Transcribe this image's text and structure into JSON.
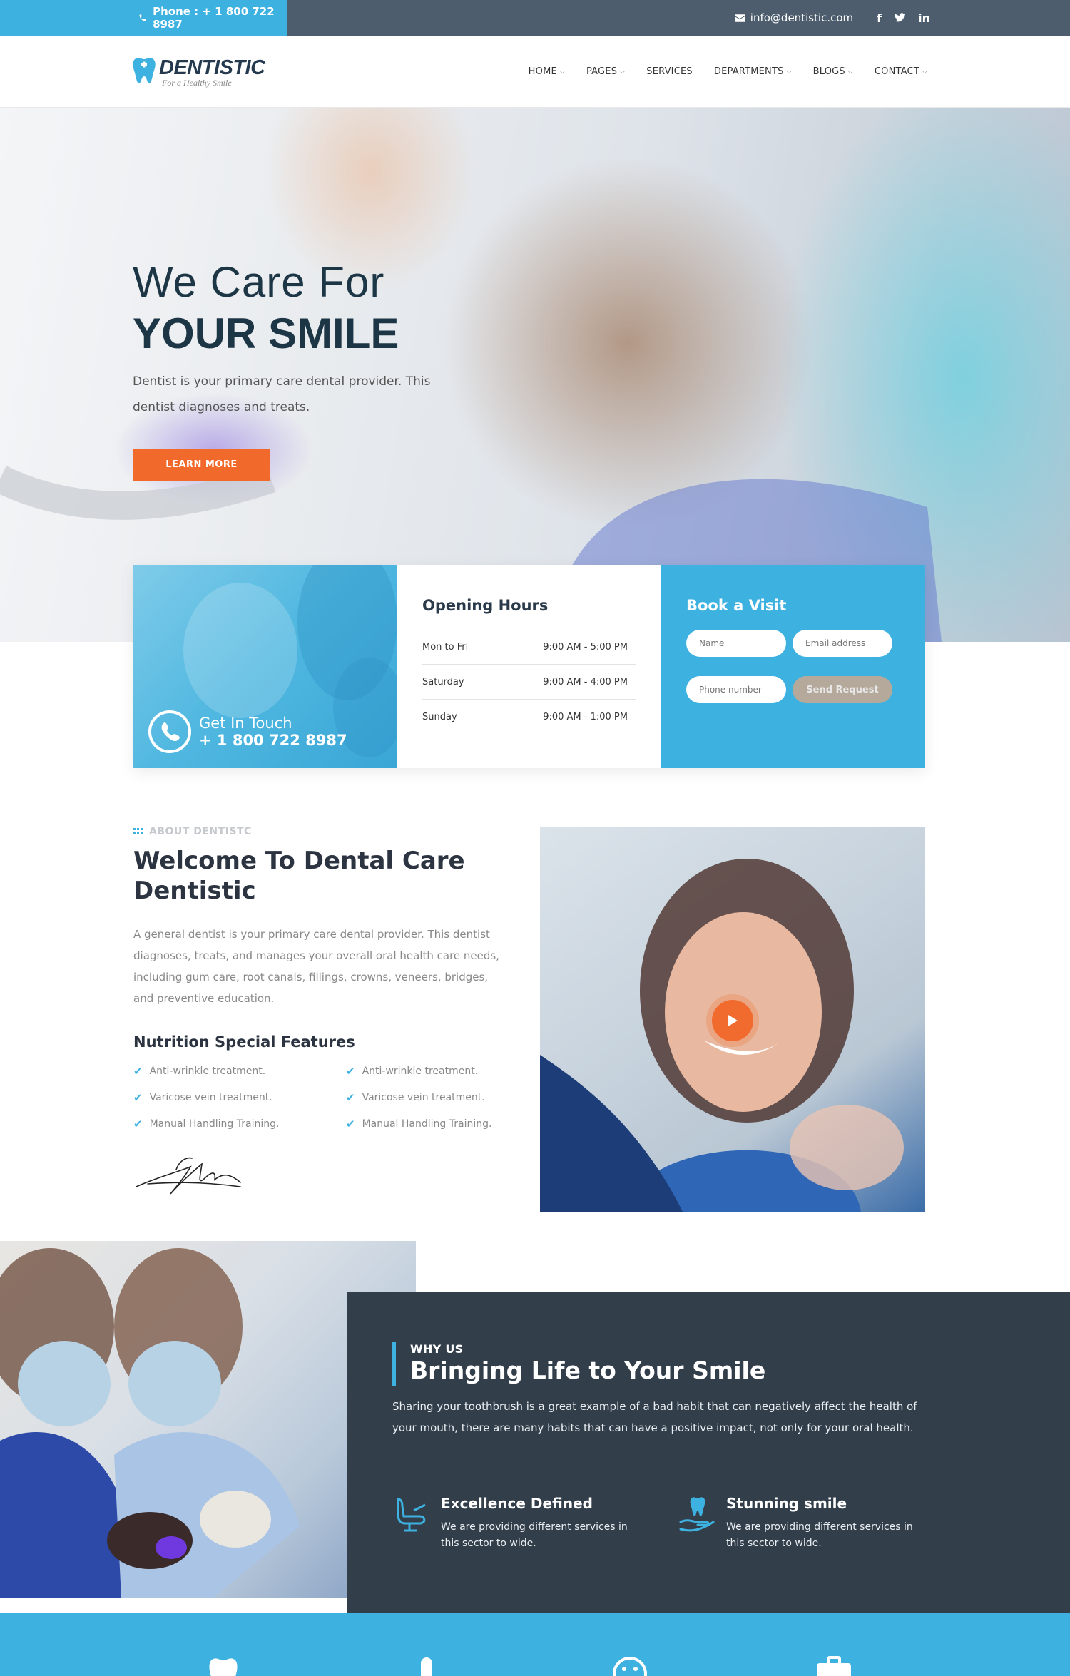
{
  "topbar": {
    "phone": "Phone : + 1 800 722 8987",
    "email": "info@dentistic.com",
    "social": [
      "f",
      "t",
      "in"
    ]
  },
  "brand": {
    "name": "DENTISTIC",
    "tagline": "For a Healthy Smile",
    "accent": "#3db1e0",
    "orange": "#f26a2b",
    "dark": "#333e4b"
  },
  "nav": {
    "items": [
      {
        "label": "HOME",
        "dropdown": true
      },
      {
        "label": "PAGES",
        "dropdown": true
      },
      {
        "label": "SERVICES",
        "dropdown": false
      },
      {
        "label": "DEPARTMENTS",
        "dropdown": true
      },
      {
        "label": "BLOGS",
        "dropdown": true
      },
      {
        "label": "CONTACT",
        "dropdown": true
      }
    ]
  },
  "hero": {
    "line1": "We Care For",
    "line2": "YOUR SMILE",
    "description": "Dentist is your primary care dental provider. This dentist diagnoses and treats.",
    "button": "LEARN MORE"
  },
  "contact_card": {
    "label": "Get In Touch",
    "phone": "+ 1 800 722 8987"
  },
  "hours": {
    "title": "Opening Hours",
    "rows": [
      {
        "day": "Mon to Fri",
        "time": "9:00 AM - 5:00 PM"
      },
      {
        "day": "Saturday",
        "time": "9:00 AM - 4:00 PM"
      },
      {
        "day": "Sunday",
        "time": "9:00 AM - 1:00 PM"
      }
    ]
  },
  "booking": {
    "title": "Book a Visit",
    "name_placeholder": "Name",
    "email_placeholder": "Email address",
    "phone_placeholder": "Phone number",
    "submit": "Send Request"
  },
  "about": {
    "eyebrow": "ABOUT DENTISTC",
    "title": "Welcome To Dental Care Dentistic",
    "text": "A general dentist is your primary care dental provider. This dentist diagnoses, treats, and manages your overall oral health care needs, including gum care, root canals, fillings, crowns, veneers, bridges, and preventive education.",
    "features_title": "Nutrition Special Features",
    "features": [
      "Anti-wrinkle treatment.",
      "Anti-wrinkle treatment.",
      "Varicose vein treatment.",
      "Varicose vein treatment.",
      "Manual Handling Training.",
      "Manual Handling Training."
    ]
  },
  "why": {
    "eyebrow": "WHY US",
    "title": "Bringing Life to Your Smile",
    "text": "Sharing your toothbrush is a great example of a bad habit that can negatively affect the health of your mouth, there are many habits that can have a positive impact, not only for your oral health.",
    "items": [
      {
        "title": "Excellence Defined",
        "text": "We are providing different services in this sector to wide.",
        "icon": "dental-chair-icon"
      },
      {
        "title": "Stunning smile",
        "text": "We are providing different services in this sector to wide.",
        "icon": "tooth-hand-icon"
      }
    ]
  }
}
